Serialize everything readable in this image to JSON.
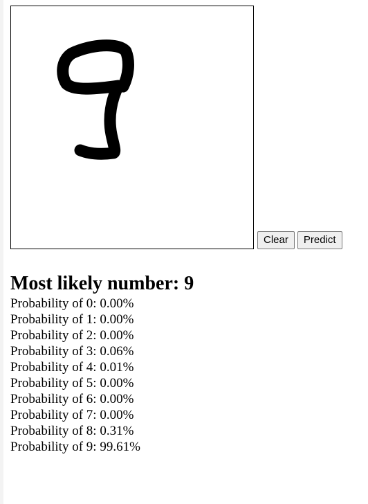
{
  "buttons": {
    "clear_label": "Clear",
    "predict_label": "Predict"
  },
  "canvas": {
    "drawn_digit": "9",
    "stroke_color": "#000000",
    "background_color": "#ffffff"
  },
  "result": {
    "heading_prefix": "Most likely number: ",
    "predicted_digit": "9",
    "probabilities": [
      {
        "label": "Probability of 0: ",
        "value": "0.00%"
      },
      {
        "label": "Probability of 1: ",
        "value": "0.00%"
      },
      {
        "label": "Probability of 2: ",
        "value": "0.00%"
      },
      {
        "label": "Probability of 3: ",
        "value": "0.06%"
      },
      {
        "label": "Probability of 4: ",
        "value": "0.01%"
      },
      {
        "label": "Probability of 5: ",
        "value": "0.00%"
      },
      {
        "label": "Probability of 6: ",
        "value": "0.00%"
      },
      {
        "label": "Probability of 7: ",
        "value": "0.00%"
      },
      {
        "label": "Probability of 8: ",
        "value": "0.31%"
      },
      {
        "label": "Probability of 9: ",
        "value": "99.61%"
      }
    ]
  }
}
